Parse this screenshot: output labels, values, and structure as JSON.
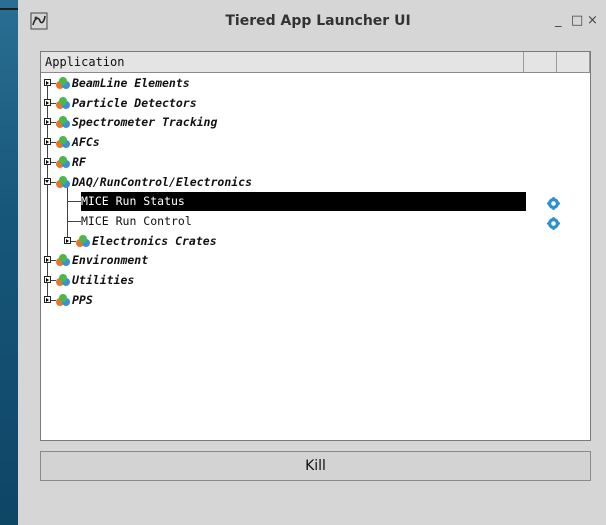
{
  "window": {
    "title": "Tiered App Launcher UI",
    "controls": {
      "minimize": "_",
      "maximize": "□",
      "close": "×"
    }
  },
  "tree": {
    "header": {
      "column": "Application"
    },
    "rows": [
      {
        "label": "BeamLine Elements",
        "type": "category",
        "expanded": false,
        "depth": 0
      },
      {
        "label": "Particle Detectors",
        "type": "category",
        "expanded": false,
        "depth": 0
      },
      {
        "label": "Spectrometer Tracking",
        "type": "category",
        "expanded": false,
        "depth": 0
      },
      {
        "label": "AFCs",
        "type": "category",
        "expanded": false,
        "depth": 0
      },
      {
        "label": "RF",
        "type": "category",
        "expanded": false,
        "depth": 0
      },
      {
        "label": "DAQ/RunControl/Electronics",
        "type": "category",
        "expanded": true,
        "depth": 0
      },
      {
        "label": "MICE Run Status",
        "type": "app",
        "selected": true,
        "depth": 1
      },
      {
        "label": "MICE Run Control",
        "type": "app",
        "selected": false,
        "depth": 1
      },
      {
        "label": "Electronics Crates",
        "type": "category",
        "expanded": false,
        "depth": 1
      },
      {
        "label": "Environment",
        "type": "category",
        "expanded": false,
        "depth": 0
      },
      {
        "label": "Utilities",
        "type": "category",
        "expanded": false,
        "depth": 0
      },
      {
        "label": "PPS",
        "type": "category",
        "expanded": false,
        "depth": 0
      }
    ]
  },
  "kill_button": {
    "label": "Kill"
  },
  "icons": {
    "category": "category-icon",
    "app_status": "gear-icon",
    "expander": "expander-icon"
  },
  "colors": {
    "selection_bg": "#000000",
    "selection_text": "#ffffff",
    "gear": "#2a8fd6"
  }
}
